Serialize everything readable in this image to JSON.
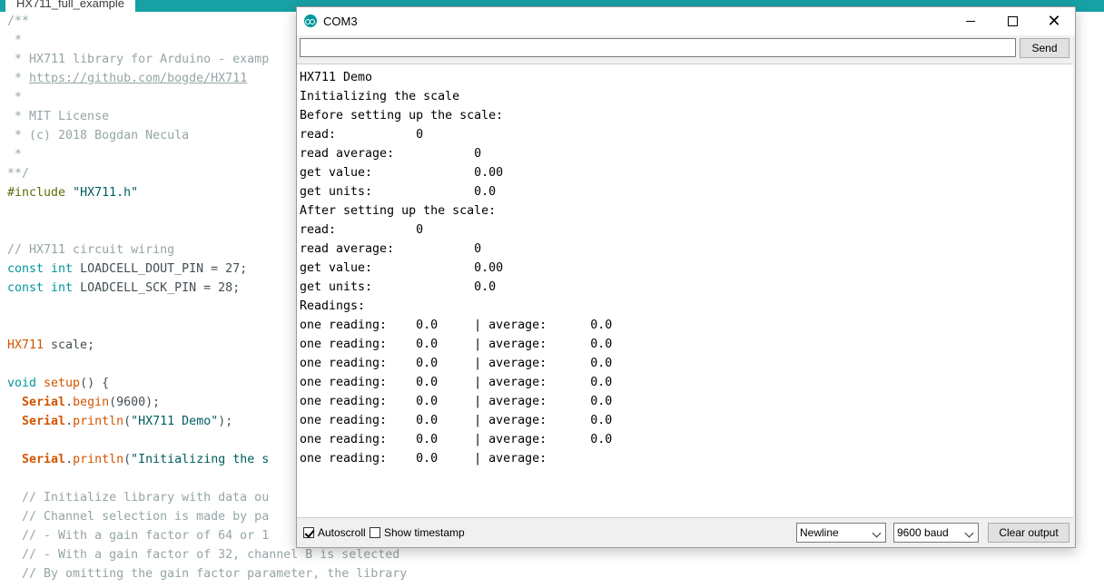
{
  "ide": {
    "tab_label": "HX711_full_example",
    "code_lines": [
      [
        {
          "t": "/**",
          "c": "c-comment"
        }
      ],
      [
        {
          "t": " *",
          "c": "c-comment"
        }
      ],
      [
        {
          "t": " * HX711 library for Arduino - examp",
          "c": "c-comment"
        }
      ],
      [
        {
          "t": " * ",
          "c": "c-comment"
        },
        {
          "t": "https://github.com/bogde/HX711",
          "c": "c-link"
        }
      ],
      [
        {
          "t": " *",
          "c": "c-comment"
        }
      ],
      [
        {
          "t": " * MIT License",
          "c": "c-comment"
        }
      ],
      [
        {
          "t": " * (c) 2018 Bogdan Necula",
          "c": "c-comment"
        }
      ],
      [
        {
          "t": " *",
          "c": "c-comment"
        }
      ],
      [
        {
          "t": "**/",
          "c": "c-comment"
        }
      ],
      [
        {
          "t": "#include ",
          "c": "c-pre"
        },
        {
          "t": "\"HX711.h\"",
          "c": "c-str"
        }
      ],
      [],
      [],
      [
        {
          "t": "// HX711 circuit wiring",
          "c": "c-comment"
        }
      ],
      [
        {
          "t": "const ",
          "c": "c-kw"
        },
        {
          "t": "int ",
          "c": "c-kw"
        },
        {
          "t": "LOADCELL_DOUT_PIN = 27;",
          "c": "c-plain"
        }
      ],
      [
        {
          "t": "const ",
          "c": "c-kw"
        },
        {
          "t": "int ",
          "c": "c-kw"
        },
        {
          "t": "LOADCELL_SCK_PIN = 28;",
          "c": "c-plain"
        }
      ],
      [],
      [],
      [
        {
          "t": "HX711",
          "c": "c-type"
        },
        {
          "t": " scale;",
          "c": "c-plain"
        }
      ],
      [],
      [
        {
          "t": "void ",
          "c": "c-kw"
        },
        {
          "t": "setup",
          "c": "c-type"
        },
        {
          "t": "() {",
          "c": "c-plain"
        }
      ],
      [
        {
          "t": "  ",
          "c": "c-plain"
        },
        {
          "t": "Serial",
          "c": "c-ser"
        },
        {
          "t": ".",
          "c": "c-plain"
        },
        {
          "t": "begin",
          "c": "c-type"
        },
        {
          "t": "(9600);",
          "c": "c-plain"
        }
      ],
      [
        {
          "t": "  ",
          "c": "c-plain"
        },
        {
          "t": "Serial",
          "c": "c-ser"
        },
        {
          "t": ".",
          "c": "c-plain"
        },
        {
          "t": "println",
          "c": "c-type"
        },
        {
          "t": "(",
          "c": "c-plain"
        },
        {
          "t": "\"HX711 Demo\"",
          "c": "c-str"
        },
        {
          "t": ");",
          "c": "c-plain"
        }
      ],
      [],
      [
        {
          "t": "  ",
          "c": "c-plain"
        },
        {
          "t": "Serial",
          "c": "c-ser"
        },
        {
          "t": ".",
          "c": "c-plain"
        },
        {
          "t": "println",
          "c": "c-type"
        },
        {
          "t": "(",
          "c": "c-plain"
        },
        {
          "t": "\"Initializing the s",
          "c": "c-str"
        }
      ],
      [],
      [
        {
          "t": "  // Initialize library with data ou",
          "c": "c-comment"
        }
      ],
      [
        {
          "t": "  // Channel selection is made by pa",
          "c": "c-comment"
        }
      ],
      [
        {
          "t": "  // - With a gain factor of 64 or 1",
          "c": "c-comment"
        }
      ],
      [
        {
          "t": "  // - With a gain factor of 32, channel B is selected",
          "c": "c-comment"
        }
      ],
      [
        {
          "t": "  // By omitting the gain factor parameter, the library",
          "c": "c-comment"
        }
      ]
    ]
  },
  "serial_monitor": {
    "title": "COM3",
    "send_label": "Send",
    "input_value": "",
    "output_lines": [
      "HX711 Demo",
      "Initializing the scale",
      "Before setting up the scale:",
      "read:           0",
      "read average:           0",
      "get value:              0.00",
      "get units:              0.0",
      "After setting up the scale:",
      "read:           0",
      "read average:           0",
      "get value:              0.00",
      "get units:              0.0",
      "Readings:",
      "one reading:    0.0     | average:      0.0",
      "one reading:    0.0     | average:      0.0",
      "one reading:    0.0     | average:      0.0",
      "one reading:    0.0     | average:      0.0",
      "one reading:    0.0     | average:      0.0",
      "one reading:    0.0     | average:      0.0",
      "one reading:    0.0     | average:      0.0",
      "one reading:    0.0     | average:"
    ],
    "autoscroll_label": "Autoscroll",
    "autoscroll_checked": true,
    "timestamp_label": "Show timestamp",
    "timestamp_checked": false,
    "line_ending": "Newline",
    "baud": "9600 baud",
    "clear_label": "Clear output"
  }
}
